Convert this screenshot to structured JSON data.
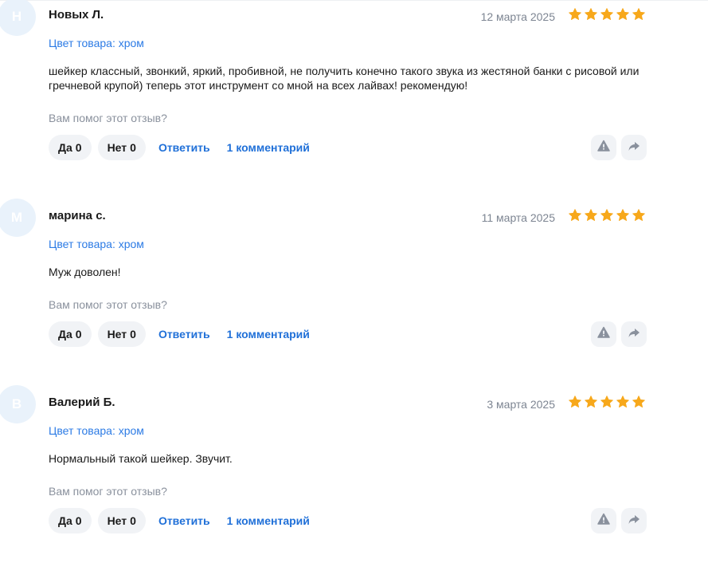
{
  "reviews": [
    {
      "initial": "Н",
      "author": "Новых Л.",
      "date": "12 марта 2025",
      "rating": 5,
      "variant": "Цвет товара: хром",
      "text": "шейкер классный, звонкий, яркий, пробивной, не получить конечно такого звука из жестяной банки с рисовой или гречневой крупой) теперь этот инструмент со мной на всех лайвах! рекомендую!",
      "helpful_question": "Вам помог этот отзыв?",
      "yes_label": "Да",
      "yes_count": "0",
      "no_label": "Нет",
      "no_count": "0",
      "reply_label": "Ответить",
      "comments_label": "1 комментарий"
    },
    {
      "initial": "М",
      "author": "марина с.",
      "date": "11 марта 2025",
      "rating": 5,
      "variant": "Цвет товара: хром",
      "text": "Муж доволен!",
      "helpful_question": "Вам помог этот отзыв?",
      "yes_label": "Да",
      "yes_count": "0",
      "no_label": "Нет",
      "no_count": "0",
      "reply_label": "Ответить",
      "comments_label": "1 комментарий"
    },
    {
      "initial": "В",
      "author": "Валерий Б.",
      "date": "3 марта 2025",
      "rating": 5,
      "variant": "Цвет товара: хром",
      "text": "Нормальный такой шейкер. Звучит.",
      "helpful_question": "Вам помог этот отзыв?",
      "yes_label": "Да",
      "yes_count": "0",
      "no_label": "Нет",
      "no_count": "0",
      "reply_label": "Ответить",
      "comments_label": "1 комментарий"
    }
  ],
  "icons": {
    "report": "warning-icon",
    "share": "share-arrow-icon",
    "star": "star-icon"
  },
  "colors": {
    "star": "#f7a81b",
    "link": "#2070d8",
    "variant": "#2c7be5",
    "avatar_bg": "#e9f2fb",
    "pill_bg": "#f1f3f6",
    "icon": "#8a919d"
  }
}
